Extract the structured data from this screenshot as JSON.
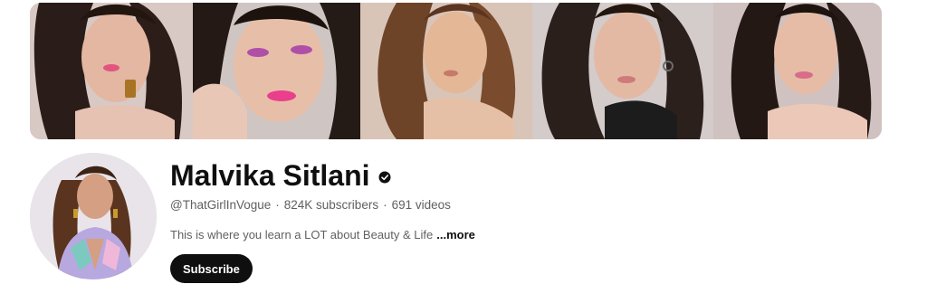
{
  "channel": {
    "name": "Malvika Sitlani",
    "verified_icon": "verified-check-icon",
    "handle": "@ThatGirlInVogue",
    "separator": "·",
    "subscribers": "824K subscribers",
    "videos": "691 videos",
    "description": "This is where you learn a LOT about Beauty & Life",
    "more_label": "...more",
    "subscribe_label": "Subscribe"
  },
  "colors": {
    "primary_text": "#0f0f0f",
    "secondary_text": "#606060",
    "subscribe_bg": "#0f0f0f",
    "subscribe_text": "#ffffff"
  },
  "banner": {
    "panels": [
      "portrait-1",
      "portrait-2",
      "portrait-3",
      "portrait-4",
      "portrait-5"
    ]
  }
}
